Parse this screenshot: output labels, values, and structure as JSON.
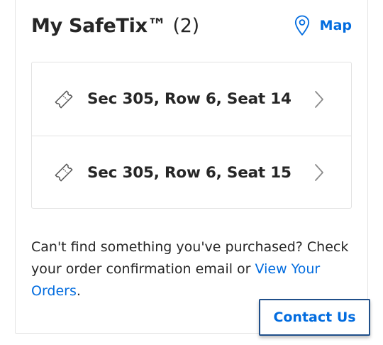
{
  "header": {
    "title": "My SafeTix™",
    "count": "(2)",
    "map_label": "Map"
  },
  "tickets": [
    {
      "label": "Sec 305, Row 6, Seat 14",
      "icon": "ticket-icon"
    },
    {
      "label": "Sec 305, Row 6, Seat 15",
      "icon": "ticket-icon"
    }
  ],
  "help": {
    "text": "Can't find something you've purchased? Check your order confirmation email or ",
    "link_text": "View Your Orders",
    "end": "."
  },
  "contact_button": "Contact Us",
  "colors": {
    "accent": "#026cdf",
    "text": "#262626",
    "border": "#e2e2e2",
    "button_border": "#1f4f8a"
  }
}
